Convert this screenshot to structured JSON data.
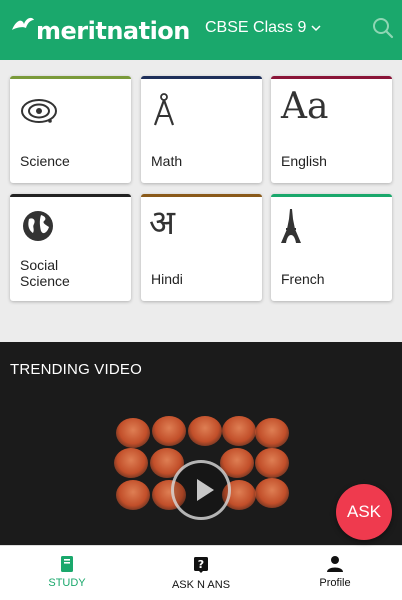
{
  "header": {
    "logo_text": "meritnation",
    "class_label": "CBSE Class 9",
    "brand_color": "#1aa86c"
  },
  "subjects": [
    {
      "label": "Science",
      "icon": "atom-icon",
      "accent": "#7a9a3a"
    },
    {
      "label": "Math",
      "icon": "compass-icon",
      "accent": "#1e2f5a"
    },
    {
      "label": "English",
      "icon": "aa-letters-icon",
      "glyph": "Aa",
      "accent": "#8a1538"
    },
    {
      "label": "Social Science",
      "icon": "globe-icon",
      "accent": "#222222"
    },
    {
      "label": "Hindi",
      "icon": "hindi-letter-icon",
      "glyph": "अ",
      "accent": "#8a5a1a"
    },
    {
      "label": "French",
      "icon": "eiffel-tower-icon",
      "accent": "#1aa86c"
    }
  ],
  "trending": {
    "title": "TRENDING VIDEO"
  },
  "fab": {
    "label": "ASK",
    "color": "#ef3a4e"
  },
  "bottom_nav": [
    {
      "label": "STUDY",
      "icon": "book-icon",
      "active": true
    },
    {
      "label": "ASK N ANS",
      "icon": "question-icon",
      "active": false
    },
    {
      "label": "Profile",
      "icon": "person-icon",
      "active": false
    }
  ]
}
